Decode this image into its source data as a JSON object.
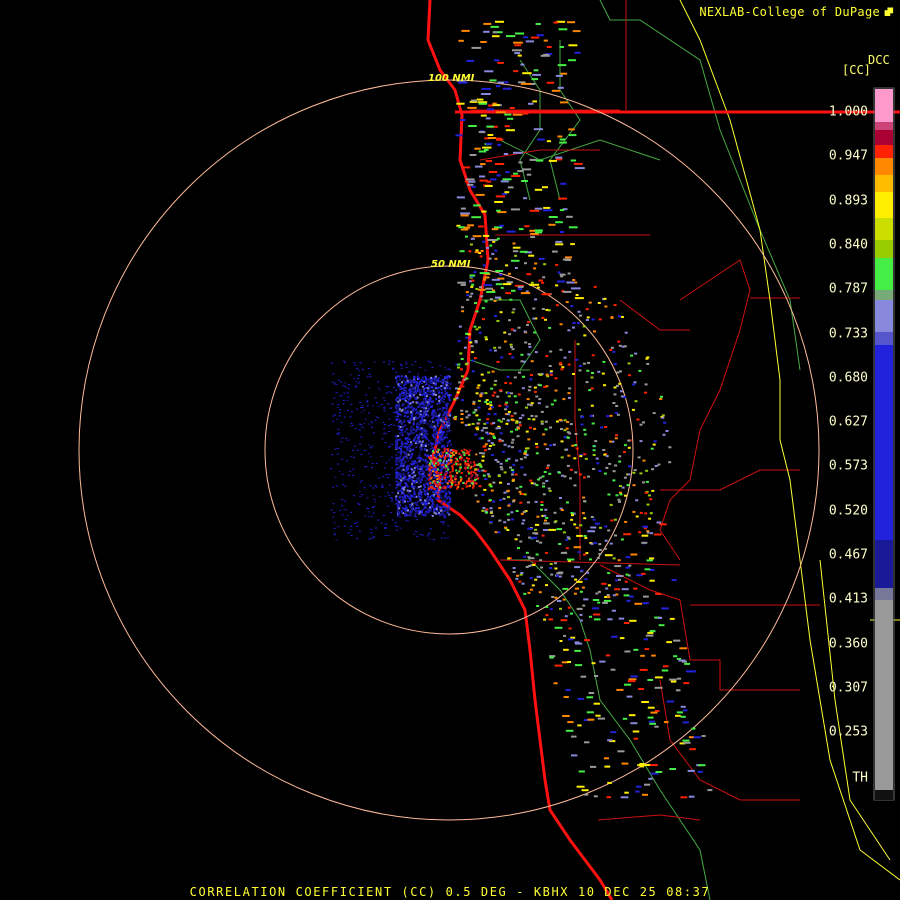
{
  "credit": {
    "text": "NEXLAB-College of DuPage",
    "logo_icon": "cod-logo-icon"
  },
  "legend": {
    "title_top": "DCC",
    "title_sub": "[CC]",
    "ticks": [
      "1.000",
      "0.947",
      "0.893",
      "0.840",
      "0.787",
      "0.733",
      "0.680",
      "0.627",
      "0.573",
      "0.520",
      "0.467",
      "0.413",
      "0.360",
      "0.307",
      "0.253",
      "TH"
    ],
    "colors": {
      "pink": "#ff99cc",
      "darkred": "#aa0033",
      "red": "#ff2200",
      "orange": "#ff8800",
      "yellow": "#ffee00",
      "olive": "#99cc00",
      "green": "#44ee44",
      "lavender": "#8888dd",
      "blue": "#2222dd",
      "darkblue": "#1a1a99",
      "gray": "#999999"
    }
  },
  "range_rings": {
    "inner_label": "50 NMI",
    "outer_label": "100 NMI"
  },
  "footer": {
    "text": "CORRELATION COEFFICIENT (CC) 0.5 DEG - KBHX 10 DEC 25 08:37"
  },
  "radar": {
    "station": "KBHX",
    "product": "CORRELATION COEFFICIENT (CC)",
    "elevation": "0.5 DEG",
    "date": "10 DEC 25",
    "time": "08:37"
  },
  "map_colors": {
    "coast": "#ff1111",
    "county": "#cc1111",
    "state": "#ffff33",
    "zone": "#44aa44",
    "ring": "#ffbb99"
  }
}
